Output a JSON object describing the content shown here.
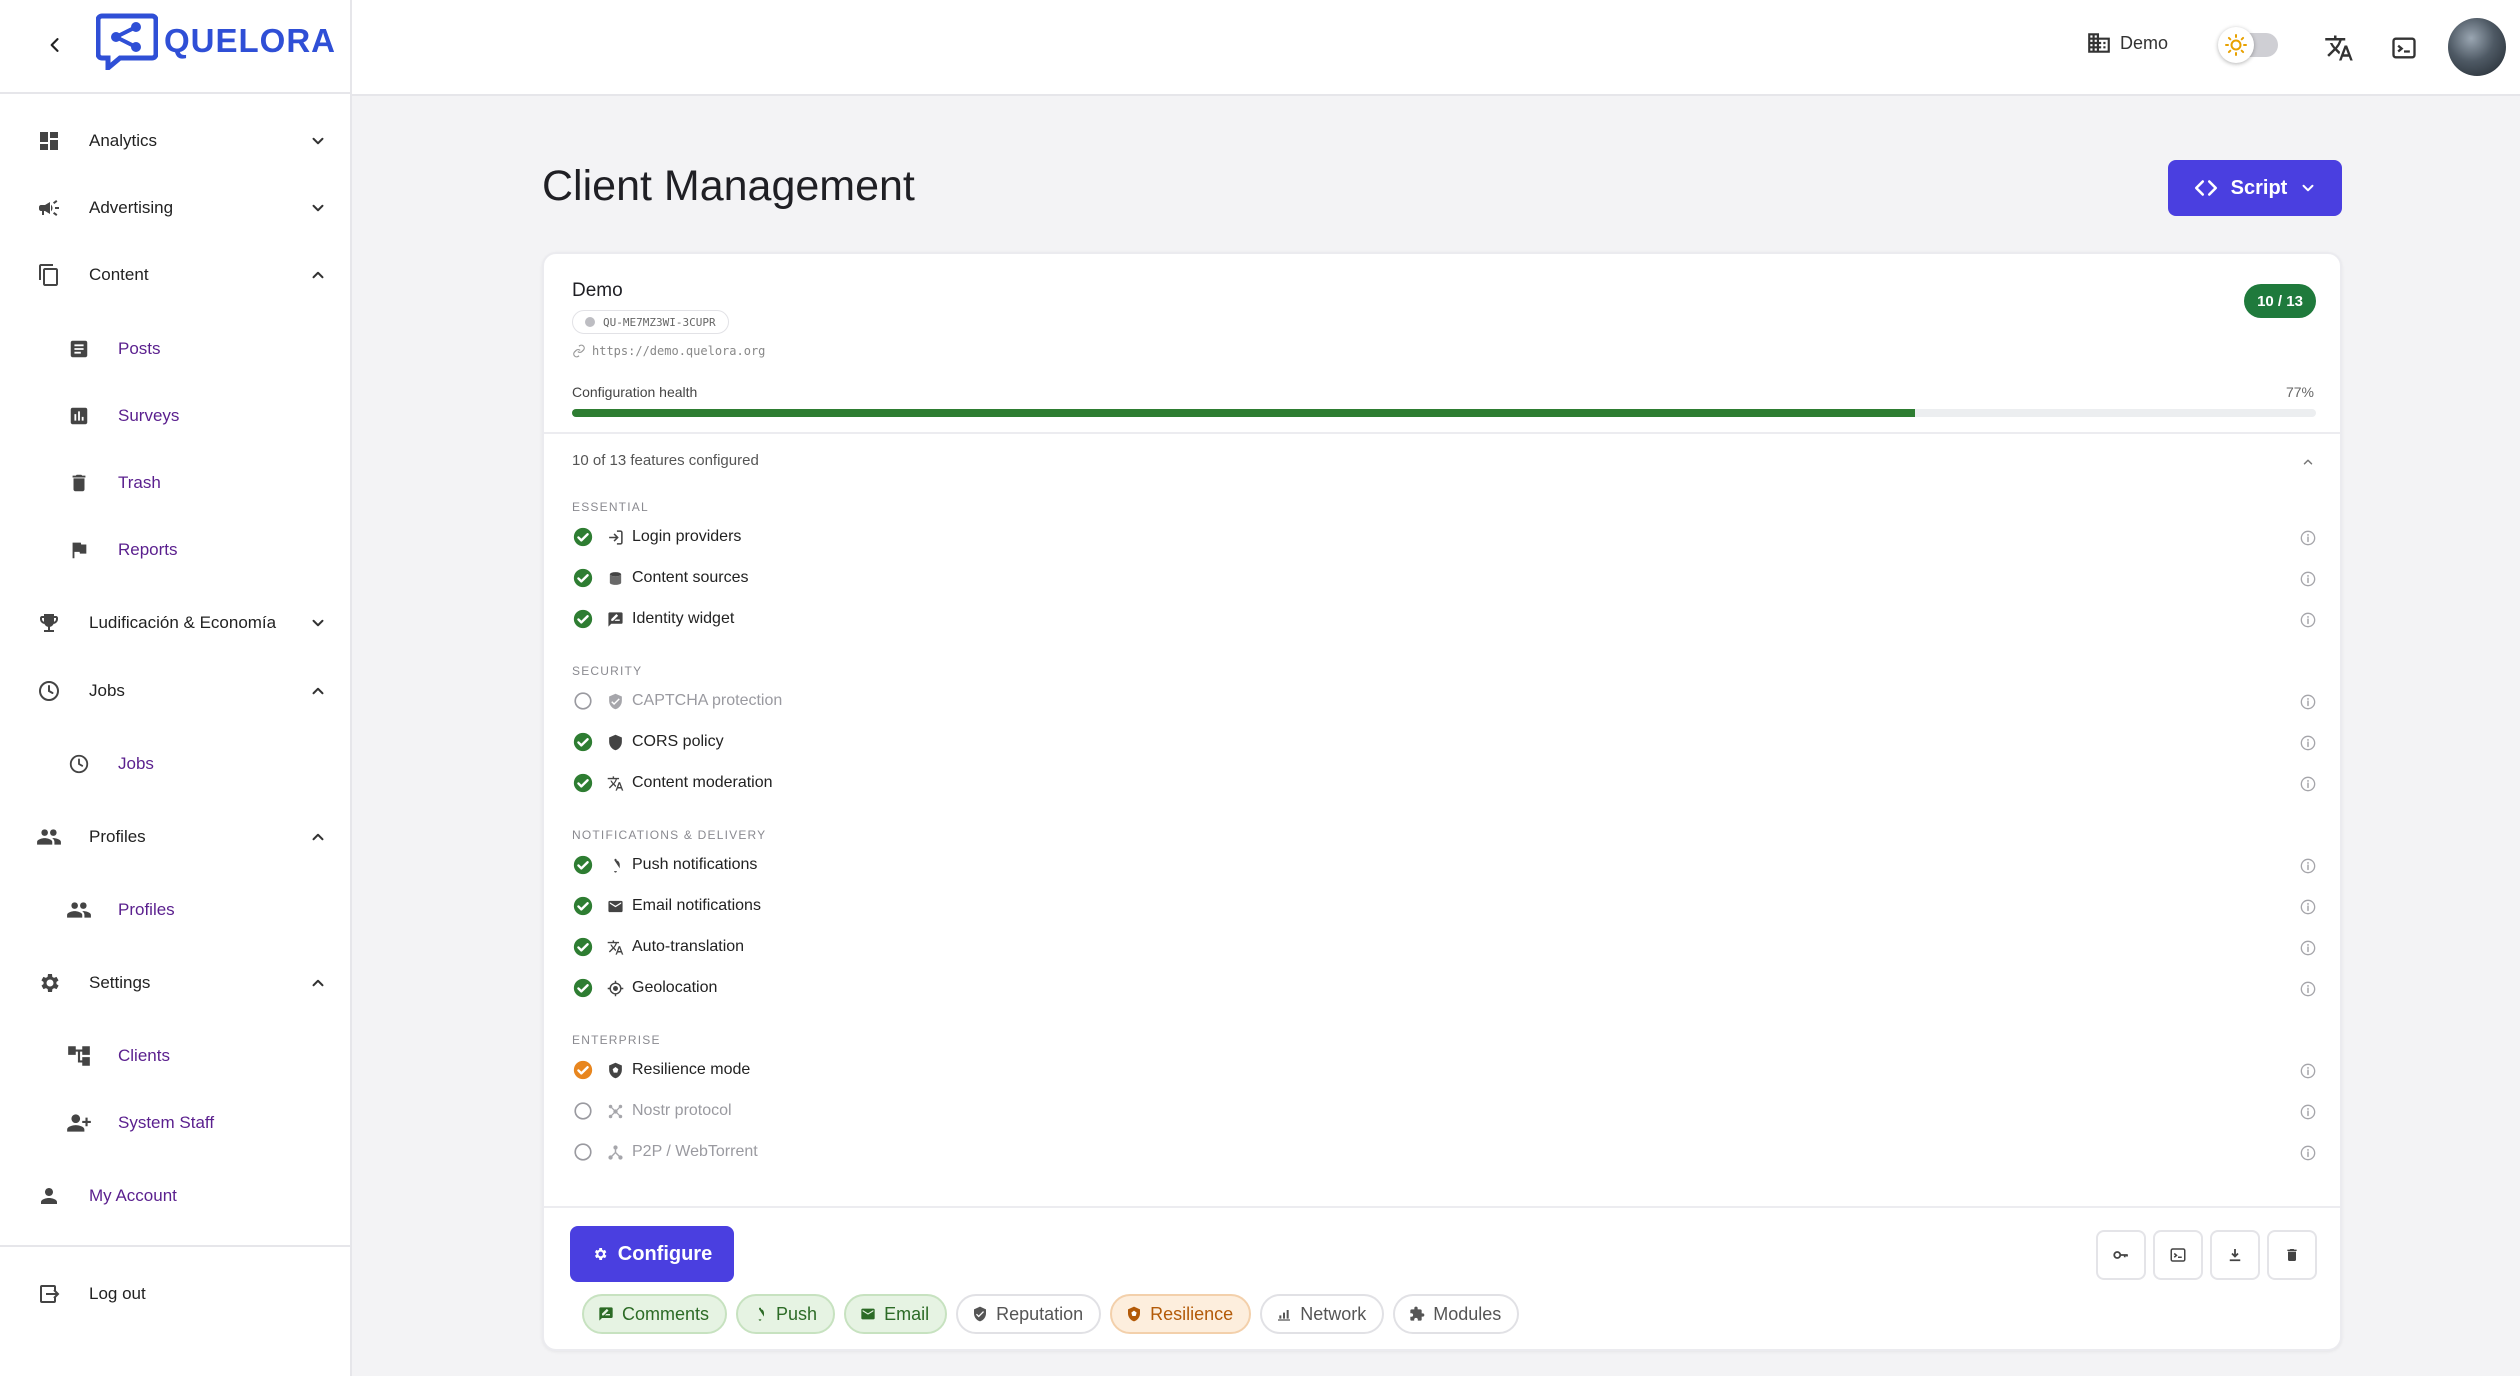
{
  "brand": {
    "name": "QUELORA",
    "color": "#2f4fd6"
  },
  "sidebar": {
    "items": [
      {
        "label": "Analytics",
        "icon": "dashboard-icon",
        "expanded": false
      },
      {
        "label": "Advertising",
        "icon": "megaphone-icon",
        "expanded": false
      },
      {
        "label": "Content",
        "icon": "copy-icon",
        "expanded": true,
        "children": [
          {
            "label": "Posts",
            "icon": "article-icon"
          },
          {
            "label": "Surveys",
            "icon": "bar-chart-icon"
          },
          {
            "label": "Trash",
            "icon": "trash-icon"
          },
          {
            "label": "Reports",
            "icon": "flag-icon"
          }
        ]
      },
      {
        "label": "Ludificación & Economía",
        "icon": "trophy-icon",
        "expanded": false
      },
      {
        "label": "Jobs",
        "icon": "clock-icon",
        "expanded": true,
        "children": [
          {
            "label": "Jobs",
            "icon": "clock-icon"
          }
        ]
      },
      {
        "label": "Profiles",
        "icon": "people-icon",
        "expanded": true,
        "children": [
          {
            "label": "Profiles",
            "icon": "people-icon"
          }
        ]
      },
      {
        "label": "Settings",
        "icon": "gear-icon",
        "expanded": true,
        "children": [
          {
            "label": "Clients",
            "icon": "hierarchy-icon"
          },
          {
            "label": "System Staff",
            "icon": "person-add-icon"
          }
        ]
      }
    ],
    "my_account": "My Account",
    "logout": "Log out"
  },
  "topbar": {
    "workspace": "Demo",
    "theme_mode": "light"
  },
  "page": {
    "title": "Client Management",
    "script_button": "Script"
  },
  "client": {
    "name": "Demo",
    "id": "QU-ME7MZ3WI-3CUPR",
    "url": "https://demo.quelora.org",
    "configured_badge": "10 / 13",
    "health_label": "Configuration health",
    "health_percent_text": "77%",
    "health_percent": 77,
    "features_summary": "10 of 13 features configured"
  },
  "feature_groups": [
    {
      "title": "ESSENTIAL",
      "features": [
        {
          "label": "Login providers",
          "icon": "login-icon",
          "status": "ok"
        },
        {
          "label": "Content sources",
          "icon": "database-icon",
          "status": "ok"
        },
        {
          "label": "Identity widget",
          "icon": "chat-icon",
          "status": "ok"
        }
      ]
    },
    {
      "title": "SECURITY",
      "features": [
        {
          "label": "CAPTCHA protection",
          "icon": "shield-check-icon",
          "status": "off"
        },
        {
          "label": "CORS policy",
          "icon": "shield-icon",
          "status": "ok"
        },
        {
          "label": "Content moderation",
          "icon": "translate-icon",
          "status": "ok"
        }
      ]
    },
    {
      "title": "NOTIFICATIONS & DELIVERY",
      "features": [
        {
          "label": "Push notifications",
          "icon": "bell-icon",
          "status": "ok"
        },
        {
          "label": "Email notifications",
          "icon": "mail-icon",
          "status": "ok"
        },
        {
          "label": "Auto-translation",
          "icon": "translate-icon",
          "status": "ok"
        },
        {
          "label": "Geolocation",
          "icon": "locate-icon",
          "status": "ok"
        }
      ]
    },
    {
      "title": "ENTERPRISE",
      "features": [
        {
          "label": "Resilience mode",
          "icon": "shield-half-icon",
          "status": "warn"
        },
        {
          "label": "Nostr protocol",
          "icon": "hub-icon",
          "status": "off"
        },
        {
          "label": "P2P / WebTorrent",
          "icon": "share-icon",
          "status": "off"
        }
      ]
    }
  ],
  "footer": {
    "configure_button": "Configure",
    "actions": [
      {
        "name": "key-icon"
      },
      {
        "name": "terminal-icon"
      },
      {
        "name": "download-icon"
      },
      {
        "name": "trash-icon"
      }
    ],
    "chips": [
      {
        "label": "Comments",
        "icon": "chat-icon",
        "style": "green"
      },
      {
        "label": "Push",
        "icon": "bell-icon",
        "style": "green"
      },
      {
        "label": "Email",
        "icon": "mail-icon",
        "style": "green"
      },
      {
        "label": "Reputation",
        "icon": "verified-icon",
        "style": "grey"
      },
      {
        "label": "Resilience",
        "icon": "shield-half-icon",
        "style": "orange"
      },
      {
        "label": "Network",
        "icon": "network-icon",
        "style": "grey"
      },
      {
        "label": "Modules",
        "icon": "puzzle-icon",
        "style": "grey"
      }
    ]
  },
  "colors": {
    "accent": "#4a3fe0",
    "success": "#2e7d32",
    "warning": "#e8861f",
    "badge": "#1f7a3c"
  }
}
